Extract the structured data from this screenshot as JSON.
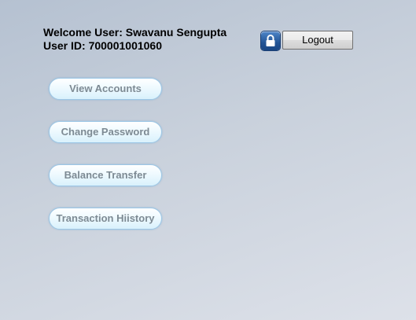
{
  "header": {
    "welcome_text": "Welcome User: Swavanu Sengupta",
    "user_id_text": "User ID: 700001001060",
    "logout_label": "Logout",
    "lock_icon": "lock-icon"
  },
  "menu": {
    "items": [
      {
        "label": "View Accounts"
      },
      {
        "label": "Change Password"
      },
      {
        "label": "Balance Transfer"
      },
      {
        "label": "Transaction Hiistory"
      }
    ]
  },
  "colors": {
    "menu_text": "#7d8a93",
    "menu_border": "#9cc7e6",
    "lock_blue": "#235596"
  }
}
